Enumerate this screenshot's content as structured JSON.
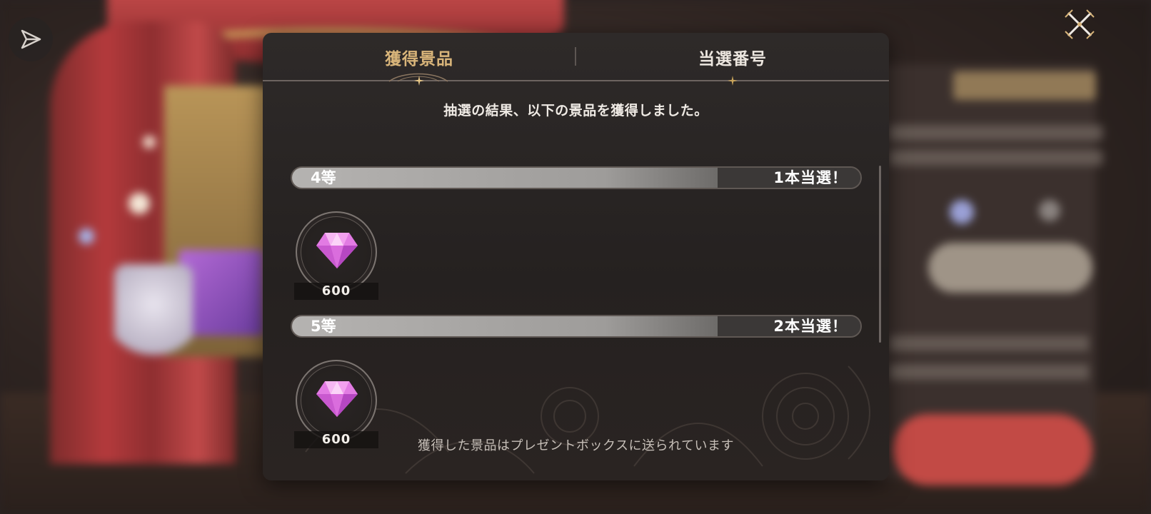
{
  "dialog": {
    "tabs": [
      {
        "label": "獲得景品",
        "active": true
      },
      {
        "label": "当選番号",
        "active": false
      }
    ],
    "headline": "抽選の結果、以下の景品を獲得しました。",
    "prizes": [
      {
        "rank": "4等",
        "count_text": "1本当選！",
        "items": [
          {
            "icon": "pink-gem-icon",
            "quantity": "600"
          }
        ]
      },
      {
        "rank": "5等",
        "count_text": "2本当選！",
        "items": [
          {
            "icon": "pink-gem-icon",
            "quantity": "600"
          }
        ]
      }
    ],
    "footer": "獲得した景品はプレゼントボックスに送られています"
  },
  "colors": {
    "active_tab": "#d9b57a",
    "dialog_bg": "#2a2524",
    "gem": "#e27be3"
  },
  "icons": {
    "top_left": "share-icon",
    "top_right": "close-icon"
  }
}
